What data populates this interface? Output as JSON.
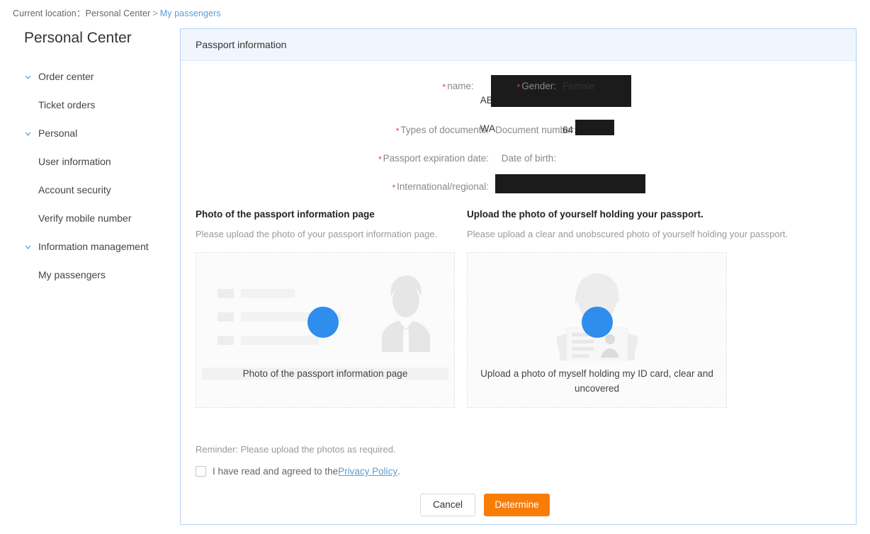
{
  "breadcrumb": {
    "prefix": "Current location：",
    "parent": "Personal Center",
    "separator": ">",
    "current": "My passengers"
  },
  "sidebar": {
    "title": "Personal Center",
    "groups": [
      {
        "label": "Order center",
        "icon": "chevron-down-icon",
        "children": [
          "Ticket orders"
        ]
      },
      {
        "label": "Personal",
        "icon": "chevron-down-icon",
        "children": [
          "User information",
          "Account security",
          "Verify mobile number"
        ]
      },
      {
        "label": "Information management",
        "icon": "chevron-down-icon",
        "children": [
          "My passengers"
        ]
      }
    ]
  },
  "panel": {
    "header": "Passport information"
  },
  "form": {
    "name": {
      "label": "name:",
      "required": true,
      "value_line1": "AB",
      "value_line2": "WA",
      "redacted": true
    },
    "gender": {
      "label": "Gender:",
      "required": true,
      "value": "Female"
    },
    "types_of_documents": {
      "label": "Types of documents:",
      "required": true,
      "value": ""
    },
    "document_number": {
      "label": "Document number:",
      "required": false,
      "value": "64",
      "redacted": true
    },
    "passport_expiration_date": {
      "label": "Passport expiration date:",
      "required": true,
      "value": ""
    },
    "date_of_birth": {
      "label": "Date of birth:",
      "required": false,
      "value": ""
    },
    "international_regional": {
      "label": "International/regional:",
      "required": true,
      "value": "",
      "redacted": true
    }
  },
  "uploads": {
    "left": {
      "title": "Photo of the passport information page",
      "description": "Please upload the photo of your passport information page.",
      "caption": "Photo of the passport information page",
      "art": "id-card-placeholder-icon"
    },
    "right": {
      "title": "Upload the photo of yourself holding your passport.",
      "description": "Please upload a clear and unobscured photo of yourself holding your passport.",
      "caption": "Upload a photo of myself holding my ID card, clear and uncovered",
      "art": "person-holding-id-placeholder-icon"
    }
  },
  "footer": {
    "reminder": "Reminder: Please upload the photos as required.",
    "agree_prefix": "I have read and agreed to the ",
    "privacy_link": "Privacy Policy",
    "agree_suffix": ".",
    "cancel_label": "Cancel",
    "determine_label": "Determine"
  },
  "colors": {
    "accent_blue": "#5b9bd5",
    "panel_border": "#b5d3f0",
    "panel_header_bg": "#eff6fd",
    "primary_button": "#f97c09",
    "required_star": "#e8402a",
    "placeholder_dot": "#2f8ded",
    "redaction": "#1b1b1b"
  }
}
